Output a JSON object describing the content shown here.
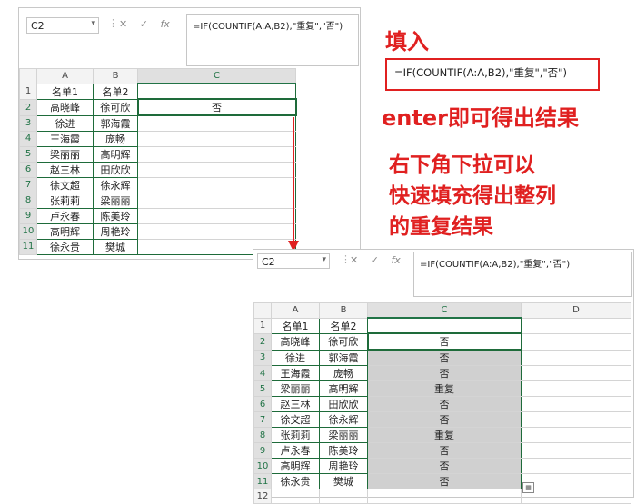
{
  "top_window": {
    "name_box": "C2",
    "fx_icons": [
      "✕",
      "✓",
      "fx"
    ],
    "formula": "=IF(COUNTIF(A:A,B2),\"重复\",\"否\")",
    "columns": [
      "A",
      "B",
      "C"
    ],
    "rows": [
      {
        "n": "1",
        "a": "名单1",
        "b": "名单2",
        "c": ""
      },
      {
        "n": "2",
        "a": "高晓峰",
        "b": "徐可欣",
        "c": "否"
      },
      {
        "n": "3",
        "a": "徐进",
        "b": "郭海霞",
        "c": ""
      },
      {
        "n": "4",
        "a": "王海霞",
        "b": "庞畅",
        "c": ""
      },
      {
        "n": "5",
        "a": "梁丽丽",
        "b": "高明辉",
        "c": ""
      },
      {
        "n": "6",
        "a": "赵三林",
        "b": "田欣欣",
        "c": ""
      },
      {
        "n": "7",
        "a": "徐文超",
        "b": "徐永辉",
        "c": ""
      },
      {
        "n": "8",
        "a": "张莉莉",
        "b": "梁丽丽",
        "c": ""
      },
      {
        "n": "9",
        "a": "卢永春",
        "b": "陈美玲",
        "c": ""
      },
      {
        "n": "10",
        "a": "高明辉",
        "b": "周艳玲",
        "c": ""
      },
      {
        "n": "11",
        "a": "徐永贵",
        "b": "樊城",
        "c": ""
      }
    ]
  },
  "bottom_window": {
    "name_box": "C2",
    "fx_icons": [
      "✕",
      "✓",
      "fx"
    ],
    "formula": "=IF(COUNTIF(A:A,B2),\"重复\",\"否\")",
    "columns": [
      "A",
      "B",
      "C",
      "D"
    ],
    "rows": [
      {
        "n": "1",
        "a": "名单1",
        "b": "名单2",
        "c": ""
      },
      {
        "n": "2",
        "a": "高晓峰",
        "b": "徐可欣",
        "c": "否"
      },
      {
        "n": "3",
        "a": "徐进",
        "b": "郭海霞",
        "c": "否"
      },
      {
        "n": "4",
        "a": "王海霞",
        "b": "庞畅",
        "c": "否"
      },
      {
        "n": "5",
        "a": "梁丽丽",
        "b": "高明辉",
        "c": "重复"
      },
      {
        "n": "6",
        "a": "赵三林",
        "b": "田欣欣",
        "c": "否"
      },
      {
        "n": "7",
        "a": "徐文超",
        "b": "徐永辉",
        "c": "否"
      },
      {
        "n": "8",
        "a": "张莉莉",
        "b": "梁丽丽",
        "c": "重复"
      },
      {
        "n": "9",
        "a": "卢永春",
        "b": "陈美玲",
        "c": "否"
      },
      {
        "n": "10",
        "a": "高明辉",
        "b": "周艳玲",
        "c": "否"
      },
      {
        "n": "11",
        "a": "徐永贵",
        "b": "樊城",
        "c": "否"
      },
      {
        "n": "12",
        "a": "",
        "b": "",
        "c": ""
      }
    ]
  },
  "annotations": {
    "fill_in": "填入",
    "formula_box": "=IF(COUNTIF(A:A,B2),\"重复\",\"否\")",
    "enter_result": "enter即可得出结果",
    "drag_line1": "右下角下拉可以",
    "drag_line2": "快速填充得出整列",
    "drag_line3": "的重复结果"
  },
  "colors": {
    "accent_red": "#e02020",
    "excel_green": "#1e6b3a",
    "fill_gray": "#d0d0d0"
  }
}
